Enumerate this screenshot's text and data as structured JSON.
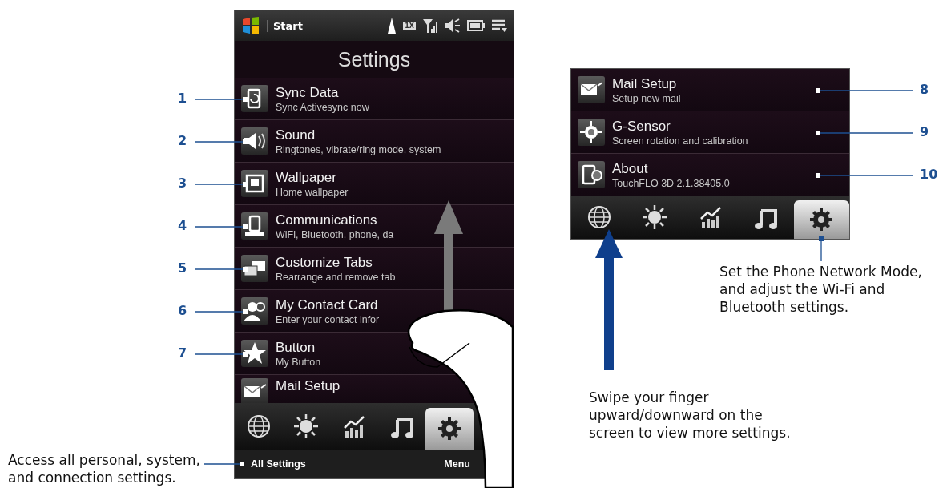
{
  "phone_main": {
    "status_bar": {
      "start_label": "Start",
      "network_label": "1X"
    },
    "title": "Settings",
    "items": [
      {
        "kind": "sync",
        "title": "Sync Data",
        "subtitle": "Sync Activesync now",
        "callout": "1"
      },
      {
        "kind": "sound",
        "title": "Sound",
        "subtitle": "Ringtones, vibrate/ring mode, system",
        "callout": "2"
      },
      {
        "kind": "wallpaper",
        "title": "Wallpaper",
        "subtitle": "Home wallpaper",
        "callout": "3"
      },
      {
        "kind": "communications",
        "title": "Communications",
        "subtitle": "WiFi, Bluetooth, phone, da",
        "callout": "4"
      },
      {
        "kind": "tabs",
        "title": "Customize Tabs",
        "subtitle": "Rearrange and remove tab",
        "callout": "5"
      },
      {
        "kind": "contact",
        "title": "My Contact Card",
        "subtitle": "Enter your contact infor",
        "callout": "6"
      },
      {
        "kind": "star",
        "title": "Button",
        "subtitle": "My Button",
        "callout": "7"
      },
      {
        "kind": "mail",
        "title": "Mail Setup"
      }
    ],
    "tabs": [
      {
        "kind": "globe",
        "selected": false
      },
      {
        "kind": "sun",
        "selected": false
      },
      {
        "kind": "chart",
        "selected": false
      },
      {
        "kind": "music",
        "selected": false
      },
      {
        "kind": "gear",
        "selected": true
      }
    ],
    "softkeys": {
      "left": "All Settings",
      "right": "Menu"
    }
  },
  "phone_detail": {
    "items": [
      {
        "kind": "mail",
        "title": "Mail Setup",
        "subtitle": "Setup new mail",
        "callout": "8"
      },
      {
        "kind": "gsensor",
        "title": "G-Sensor",
        "subtitle": "Screen rotation and calibration",
        "callout": "9"
      },
      {
        "kind": "about",
        "title": "About",
        "subtitle": "TouchFLO 3D 2.1.38405.0",
        "callout": "10"
      }
    ],
    "tabs": [
      {
        "kind": "globe",
        "selected": false
      },
      {
        "kind": "sun",
        "selected": false
      },
      {
        "kind": "chart",
        "selected": false
      },
      {
        "kind": "music",
        "selected": false
      },
      {
        "kind": "gear",
        "selected": true
      }
    ]
  },
  "notes": {
    "all_settings": "Access all personal, system, and connection settings.",
    "settings_tab": "Set the Phone Network Mode, and adjust the Wi-Fi and Bluetooth settings.",
    "swipe": "Swipe your finger upward/downward on the screen to view more settings."
  }
}
